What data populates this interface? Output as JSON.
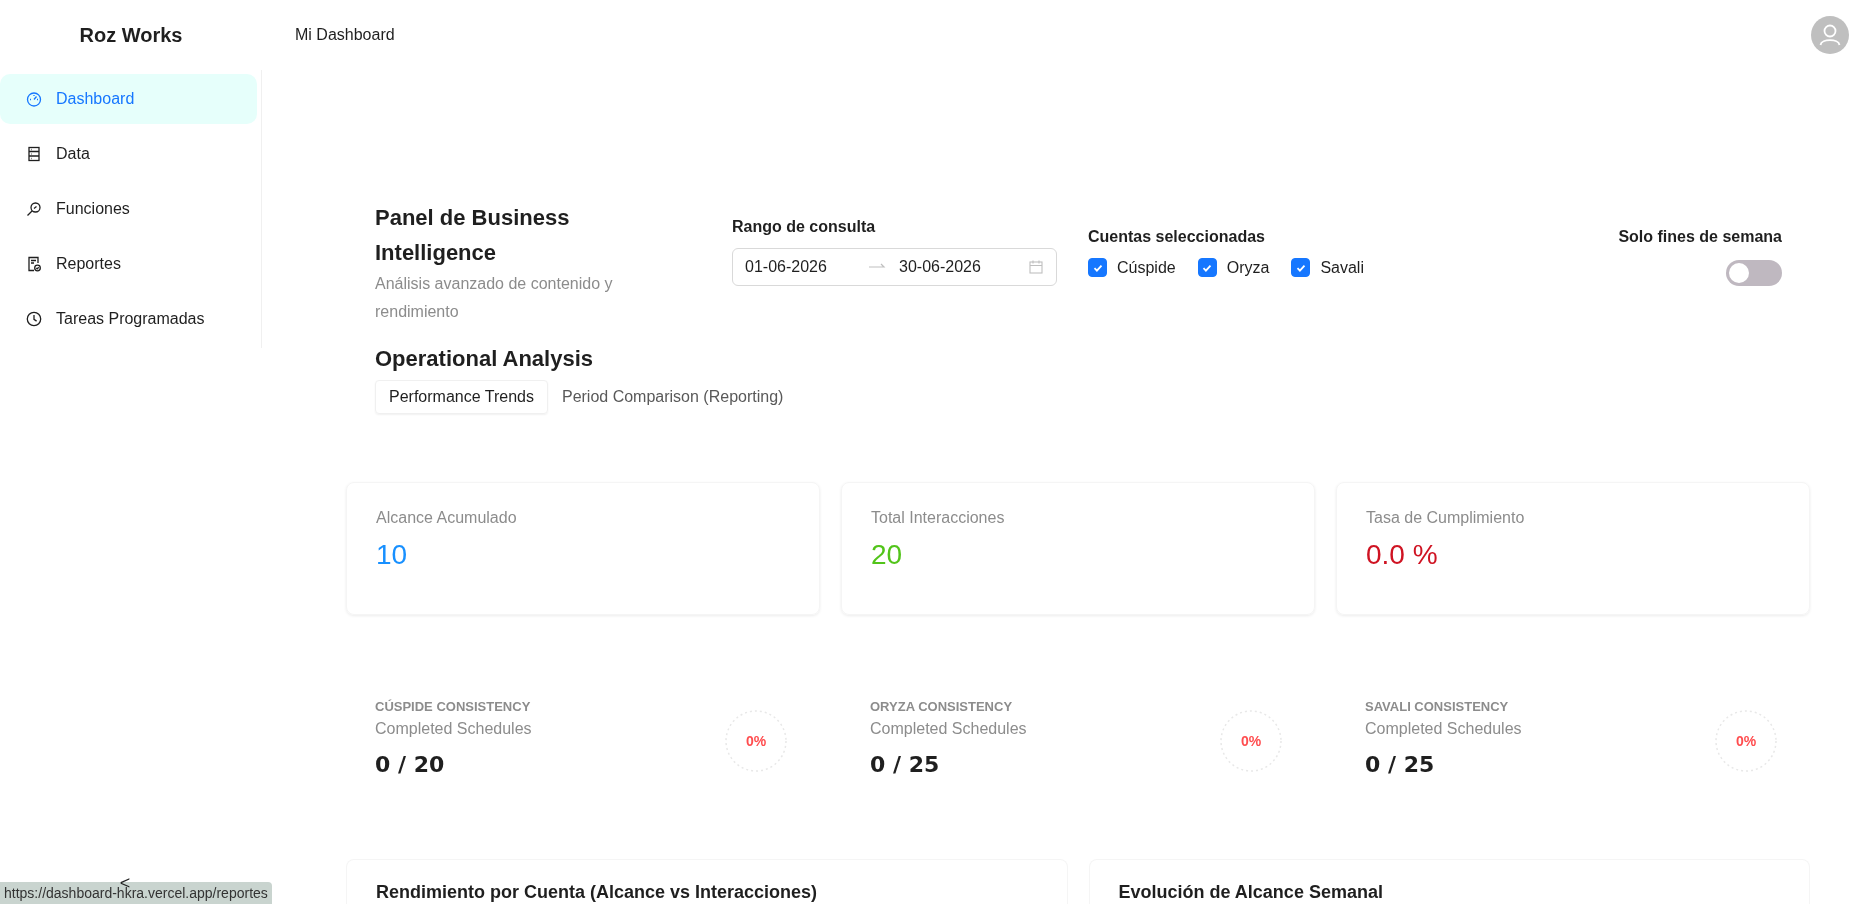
{
  "brand": "Roz Works",
  "header": {
    "title": "Mi Dashboard"
  },
  "sidebar": {
    "items": [
      {
        "label": "Dashboard",
        "kind": "gauge",
        "selected": true
      },
      {
        "label": "Data",
        "kind": "table",
        "selected": false
      },
      {
        "label": "Funciones",
        "kind": "search",
        "selected": false
      },
      {
        "label": "Reportes",
        "kind": "report",
        "selected": false
      },
      {
        "label": "Tareas Programadas",
        "kind": "clock",
        "selected": false
      }
    ]
  },
  "panel": {
    "title": "Panel de Business Intelligence",
    "subtitle": "Análisis avanzado de contenido y rendimiento"
  },
  "date_range": {
    "label": "Rango de consulta",
    "start": "01-06-2026",
    "end": "30-06-2026"
  },
  "accounts": {
    "label": "Cuentas seleccionadas",
    "items": [
      {
        "label": "Cúspide",
        "checked": true
      },
      {
        "label": "Oryza",
        "checked": true
      },
      {
        "label": "Savali",
        "checked": true
      }
    ]
  },
  "weekend_toggle": {
    "label": "Solo fines de semana",
    "on": false
  },
  "analysis": {
    "title": "Operational Analysis",
    "tabs": [
      {
        "label": "Performance Trends",
        "selected": true
      },
      {
        "label": "Period Comparison (Reporting)",
        "selected": false
      }
    ]
  },
  "stats": [
    {
      "label": "Alcance Acumulado",
      "value": "10",
      "color": "#1890ff"
    },
    {
      "label": "Total Interacciones",
      "value": "20",
      "color": "#52c41a"
    },
    {
      "label": "Tasa de Cumplimiento",
      "value": "0.0 %",
      "color": "#cf1322"
    }
  ],
  "consistency": [
    {
      "title": "CÚSPIDE CONSISTENCY",
      "subtitle": "Completed Schedules",
      "value": "0 / 20",
      "percent": "0%"
    },
    {
      "title": "ORYZA CONSISTENCY",
      "subtitle": "Completed Schedules",
      "value": "0 / 25",
      "percent": "0%"
    },
    {
      "title": "SAVALI CONSISTENCY",
      "subtitle": "Completed Schedules",
      "value": "0 / 25",
      "percent": "0%"
    }
  ],
  "bottom_cards": [
    {
      "title": "Rendimiento por Cuenta (Alcance vs Interacciones)"
    },
    {
      "title": "Evolución de Alcance Semanal"
    }
  ],
  "collapse_button": "<",
  "status_url": "https://dashboard-hkra.vercel.app/reportes"
}
